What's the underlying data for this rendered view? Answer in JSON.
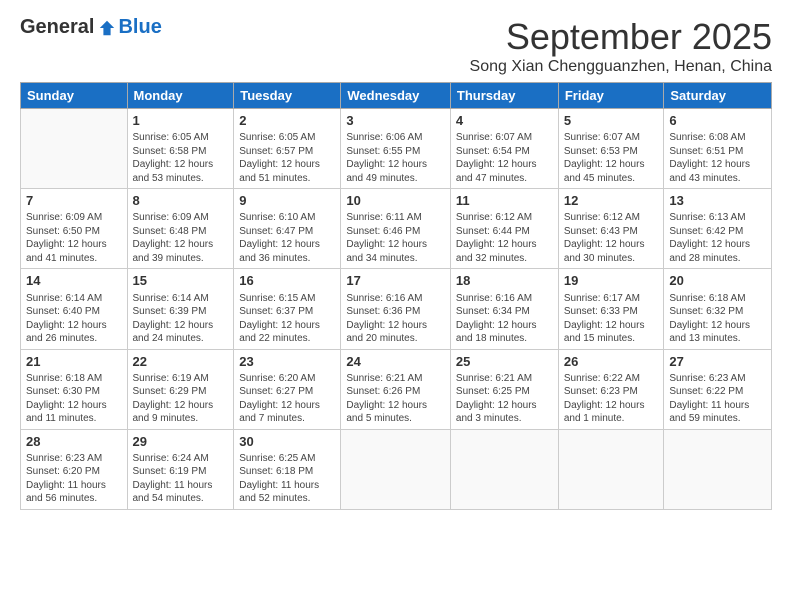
{
  "header": {
    "logo_general": "General",
    "logo_blue": "Blue",
    "month_title": "September 2025",
    "subtitle": "Song Xian Chengguanzhen, Henan, China"
  },
  "weekdays": [
    "Sunday",
    "Monday",
    "Tuesday",
    "Wednesday",
    "Thursday",
    "Friday",
    "Saturday"
  ],
  "weeks": [
    [
      {
        "date": "",
        "info": ""
      },
      {
        "date": "1",
        "info": "Sunrise: 6:05 AM\nSunset: 6:58 PM\nDaylight: 12 hours\nand 53 minutes."
      },
      {
        "date": "2",
        "info": "Sunrise: 6:05 AM\nSunset: 6:57 PM\nDaylight: 12 hours\nand 51 minutes."
      },
      {
        "date": "3",
        "info": "Sunrise: 6:06 AM\nSunset: 6:55 PM\nDaylight: 12 hours\nand 49 minutes."
      },
      {
        "date": "4",
        "info": "Sunrise: 6:07 AM\nSunset: 6:54 PM\nDaylight: 12 hours\nand 47 minutes."
      },
      {
        "date": "5",
        "info": "Sunrise: 6:07 AM\nSunset: 6:53 PM\nDaylight: 12 hours\nand 45 minutes."
      },
      {
        "date": "6",
        "info": "Sunrise: 6:08 AM\nSunset: 6:51 PM\nDaylight: 12 hours\nand 43 minutes."
      }
    ],
    [
      {
        "date": "7",
        "info": "Sunrise: 6:09 AM\nSunset: 6:50 PM\nDaylight: 12 hours\nand 41 minutes."
      },
      {
        "date": "8",
        "info": "Sunrise: 6:09 AM\nSunset: 6:48 PM\nDaylight: 12 hours\nand 39 minutes."
      },
      {
        "date": "9",
        "info": "Sunrise: 6:10 AM\nSunset: 6:47 PM\nDaylight: 12 hours\nand 36 minutes."
      },
      {
        "date": "10",
        "info": "Sunrise: 6:11 AM\nSunset: 6:46 PM\nDaylight: 12 hours\nand 34 minutes."
      },
      {
        "date": "11",
        "info": "Sunrise: 6:12 AM\nSunset: 6:44 PM\nDaylight: 12 hours\nand 32 minutes."
      },
      {
        "date": "12",
        "info": "Sunrise: 6:12 AM\nSunset: 6:43 PM\nDaylight: 12 hours\nand 30 minutes."
      },
      {
        "date": "13",
        "info": "Sunrise: 6:13 AM\nSunset: 6:42 PM\nDaylight: 12 hours\nand 28 minutes."
      }
    ],
    [
      {
        "date": "14",
        "info": "Sunrise: 6:14 AM\nSunset: 6:40 PM\nDaylight: 12 hours\nand 26 minutes."
      },
      {
        "date": "15",
        "info": "Sunrise: 6:14 AM\nSunset: 6:39 PM\nDaylight: 12 hours\nand 24 minutes."
      },
      {
        "date": "16",
        "info": "Sunrise: 6:15 AM\nSunset: 6:37 PM\nDaylight: 12 hours\nand 22 minutes."
      },
      {
        "date": "17",
        "info": "Sunrise: 6:16 AM\nSunset: 6:36 PM\nDaylight: 12 hours\nand 20 minutes."
      },
      {
        "date": "18",
        "info": "Sunrise: 6:16 AM\nSunset: 6:34 PM\nDaylight: 12 hours\nand 18 minutes."
      },
      {
        "date": "19",
        "info": "Sunrise: 6:17 AM\nSunset: 6:33 PM\nDaylight: 12 hours\nand 15 minutes."
      },
      {
        "date": "20",
        "info": "Sunrise: 6:18 AM\nSunset: 6:32 PM\nDaylight: 12 hours\nand 13 minutes."
      }
    ],
    [
      {
        "date": "21",
        "info": "Sunrise: 6:18 AM\nSunset: 6:30 PM\nDaylight: 12 hours\nand 11 minutes."
      },
      {
        "date": "22",
        "info": "Sunrise: 6:19 AM\nSunset: 6:29 PM\nDaylight: 12 hours\nand 9 minutes."
      },
      {
        "date": "23",
        "info": "Sunrise: 6:20 AM\nSunset: 6:27 PM\nDaylight: 12 hours\nand 7 minutes."
      },
      {
        "date": "24",
        "info": "Sunrise: 6:21 AM\nSunset: 6:26 PM\nDaylight: 12 hours\nand 5 minutes."
      },
      {
        "date": "25",
        "info": "Sunrise: 6:21 AM\nSunset: 6:25 PM\nDaylight: 12 hours\nand 3 minutes."
      },
      {
        "date": "26",
        "info": "Sunrise: 6:22 AM\nSunset: 6:23 PM\nDaylight: 12 hours\nand 1 minute."
      },
      {
        "date": "27",
        "info": "Sunrise: 6:23 AM\nSunset: 6:22 PM\nDaylight: 11 hours\nand 59 minutes."
      }
    ],
    [
      {
        "date": "28",
        "info": "Sunrise: 6:23 AM\nSunset: 6:20 PM\nDaylight: 11 hours\nand 56 minutes."
      },
      {
        "date": "29",
        "info": "Sunrise: 6:24 AM\nSunset: 6:19 PM\nDaylight: 11 hours\nand 54 minutes."
      },
      {
        "date": "30",
        "info": "Sunrise: 6:25 AM\nSunset: 6:18 PM\nDaylight: 11 hours\nand 52 minutes."
      },
      {
        "date": "",
        "info": ""
      },
      {
        "date": "",
        "info": ""
      },
      {
        "date": "",
        "info": ""
      },
      {
        "date": "",
        "info": ""
      }
    ]
  ]
}
